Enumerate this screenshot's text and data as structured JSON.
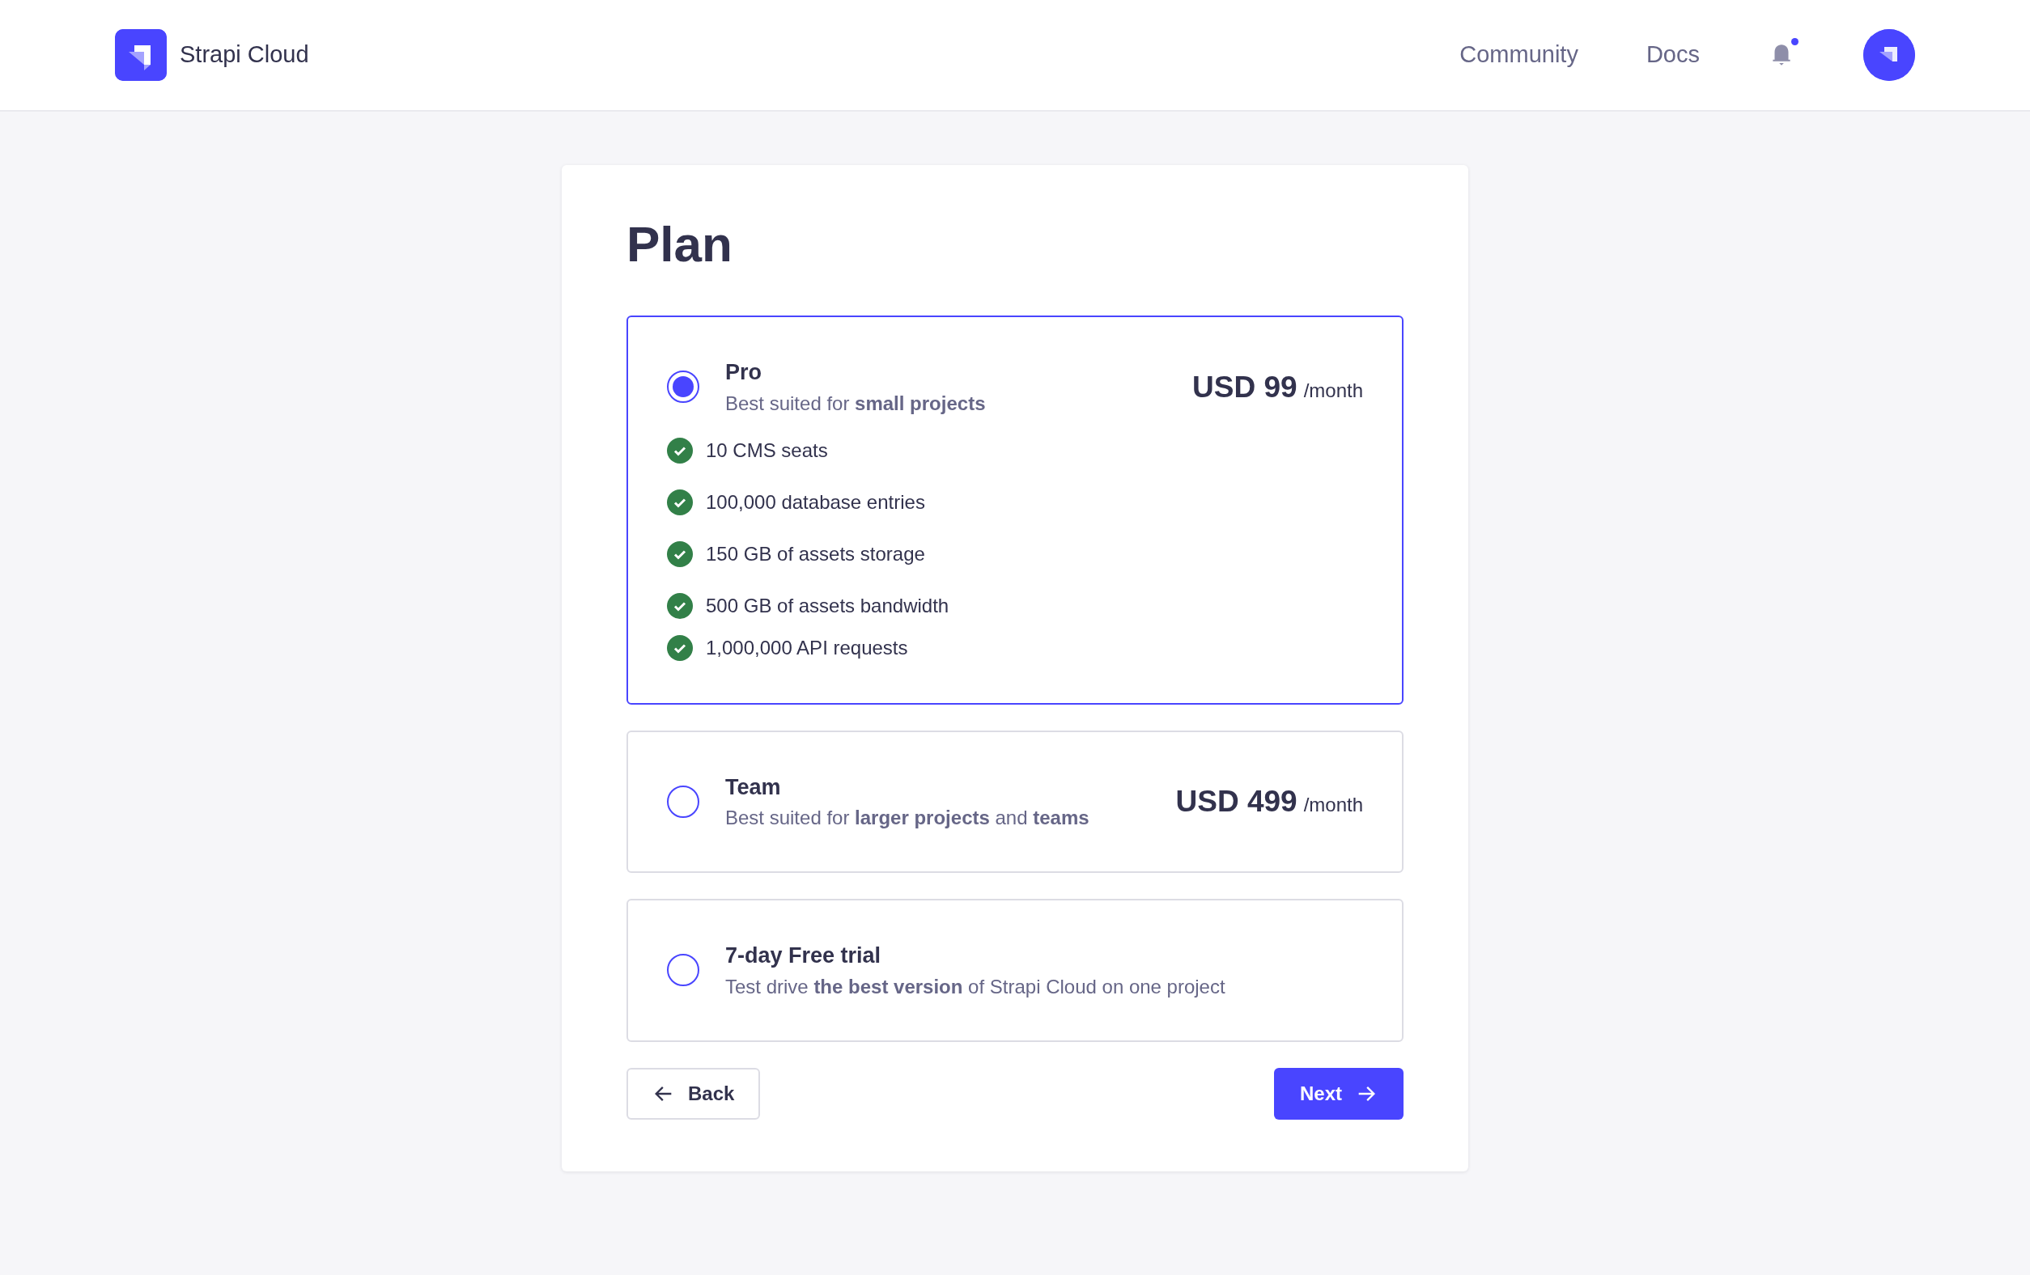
{
  "header": {
    "brand": "Strapi Cloud",
    "links": [
      "Community",
      "Docs"
    ],
    "notifications_unread": true
  },
  "title": "Plan",
  "plans": [
    {
      "name": "Pro",
      "description": "Best suited for **small projects**",
      "price": "USD 99",
      "period": "/month",
      "selected": true,
      "features": [
        "10 CMS seats",
        "100,000 database entries",
        "150 GB of assets storage",
        "500 GB of assets bandwidth",
        "1,000,000 API requests"
      ]
    },
    {
      "name": "Team",
      "description": "Best suited for **larger projects** and **teams**",
      "price": "USD 499",
      "period": "/month",
      "selected": false
    },
    {
      "name": "7-day Free trial",
      "description": "Test drive **the best version** of Strapi Cloud on one project",
      "selected": false
    }
  ],
  "actions": {
    "back": "Back",
    "next": "Next"
  }
}
